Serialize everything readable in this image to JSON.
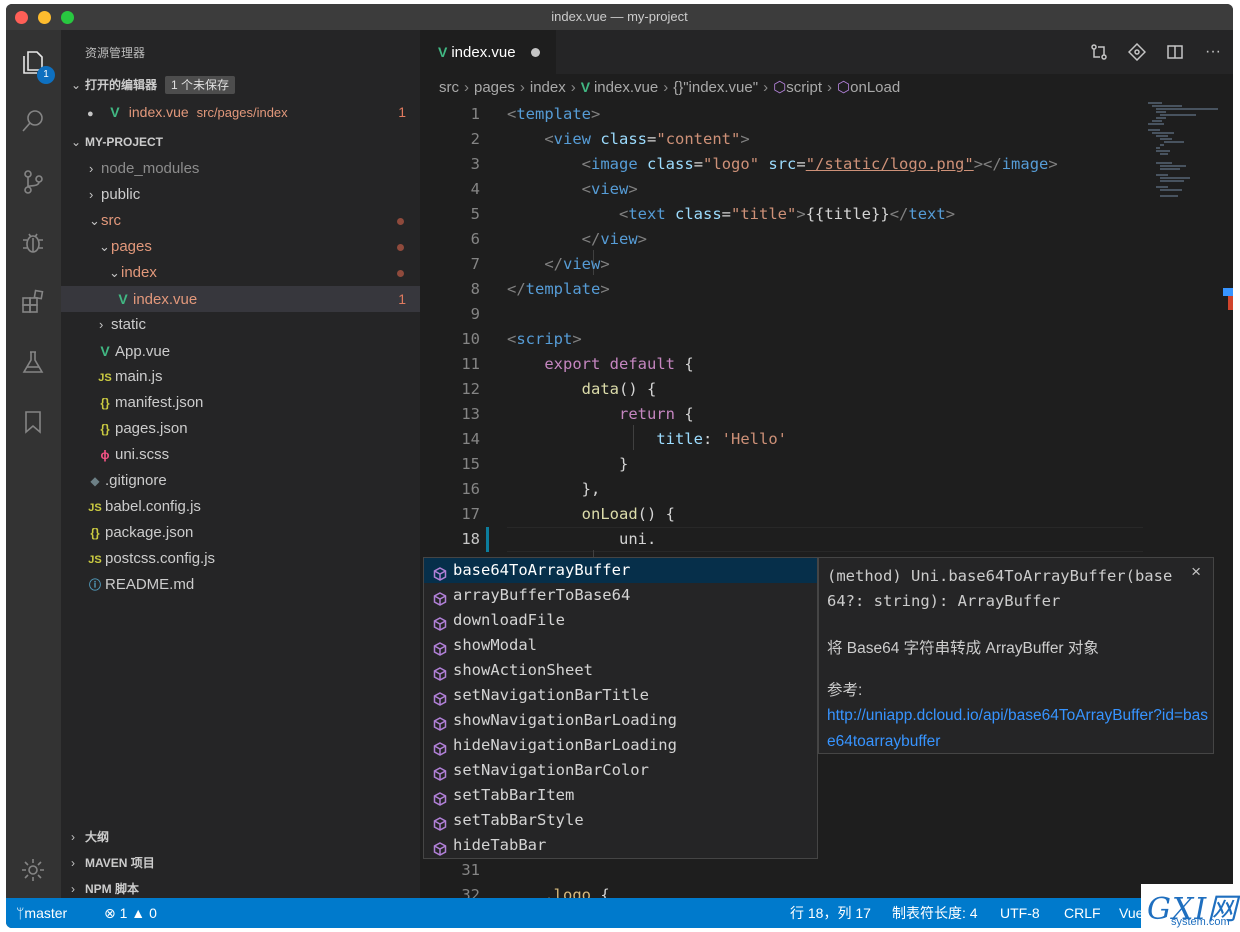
{
  "window": {
    "title": "index.vue — my-project"
  },
  "activity_bar": {
    "explorer_badge": "1"
  },
  "sidebar": {
    "title": "资源管理器",
    "open_editors": {
      "label": "打开的编辑器",
      "unsaved_badge": "1 个未保存"
    },
    "open_file": {
      "name": "index.vue",
      "path": "src/pages/index",
      "problems": "1"
    },
    "project": {
      "label": "MY-PROJECT"
    },
    "tree": [
      {
        "label": "node_modules"
      },
      {
        "label": "public"
      },
      {
        "label": "src"
      },
      {
        "label": "pages"
      },
      {
        "label": "index"
      },
      {
        "label": "index.vue",
        "problems": "1"
      },
      {
        "label": "static"
      },
      {
        "label": "App.vue"
      },
      {
        "label": "main.js"
      },
      {
        "label": "manifest.json"
      },
      {
        "label": "pages.json"
      },
      {
        "label": "uni.scss"
      },
      {
        "label": ".gitignore"
      },
      {
        "label": "babel.config.js"
      },
      {
        "label": "package.json"
      },
      {
        "label": "postcss.config.js"
      },
      {
        "label": "README.md"
      }
    ],
    "file_icons": {
      "js": "JS",
      "json": "{}"
    },
    "bottom_sections": [
      {
        "label": "大纲"
      },
      {
        "label": "MAVEN 项目"
      },
      {
        "label": "NPM 脚本"
      }
    ]
  },
  "tab": {
    "label": "index.vue"
  },
  "breadcrumb": {
    "items": [
      "src",
      "pages",
      "index",
      "index.vue",
      "{}\"index.vue\"",
      "script",
      "onLoad"
    ]
  },
  "editor": {
    "line_numbers": [
      "1",
      "2",
      "3",
      "4",
      "5",
      "6",
      "7",
      "8",
      "9",
      "10",
      "11",
      "12",
      "13",
      "14",
      "15",
      "16",
      "17",
      "18",
      "31",
      "32"
    ],
    "code": {
      "l1_tag": "template",
      "l2_tag": "view",
      "l2_attr": "class",
      "l2_val": "\"content\"",
      "l3_tag": "image",
      "l3_attr1": "class",
      "l3_val1": "\"logo\"",
      "l3_attr2": "src",
      "l3_val2": "\"/static/logo.png\"",
      "l3_close": "image",
      "l4_tag": "view",
      "l5_tag": "text",
      "l5_attr": "class",
      "l5_val": "\"title\"",
      "l5_text": "{{title}}",
      "l5_close": "text",
      "l6_tag": "view",
      "l7_tag": "view",
      "l8_tag": "template",
      "l10_tag": "script",
      "l11_kw1": "export",
      "l11_kw2": "default",
      "l11_rest": " {",
      "l12_fn": "data",
      "l12_rest": "() {",
      "l13_kw": "return",
      "l13_rest": " {",
      "l14_prop": "title",
      "l14_colon": ": ",
      "l14_val": "'Hello'",
      "l15": "}",
      "l16": "},",
      "l17_fn": "onLoad",
      "l17_rest": "() {",
      "l18": "uni.",
      "l32_sel": ".logo",
      "l32_rest": " {"
    }
  },
  "suggestions": [
    "base64ToArrayBuffer",
    "arrayBufferToBase64",
    "downloadFile",
    "showModal",
    "showActionSheet",
    "setNavigationBarTitle",
    "showNavigationBarLoading",
    "hideNavigationBarLoading",
    "setNavigationBarColor",
    "setTabBarItem",
    "setTabBarStyle",
    "hideTabBar"
  ],
  "details": {
    "signature": "(method) Uni.base64ToArrayBuffer(base64?: string): ArrayBuffer",
    "close": "×",
    "description": "将 Base64 字符串转成 ArrayBuffer 对象",
    "ref_label": "参考:",
    "link": "http://uniapp.dcloud.io/api/base64ToArrayBuffer?id=base64toarraybuffer"
  },
  "statusbar": {
    "branch": "master",
    "errors": "1",
    "warnings": "0",
    "position": "行 18，列 17",
    "tab_size": "制表符长度: 4",
    "encoding": "UTF-8",
    "eol": "CRLF",
    "language": "Vue"
  },
  "watermark": {
    "logo": "GXI网",
    "site": "system.com"
  },
  "colors": {
    "statusbar": "#007acc",
    "accent": "#0e70c0",
    "vue": "#41b883"
  }
}
